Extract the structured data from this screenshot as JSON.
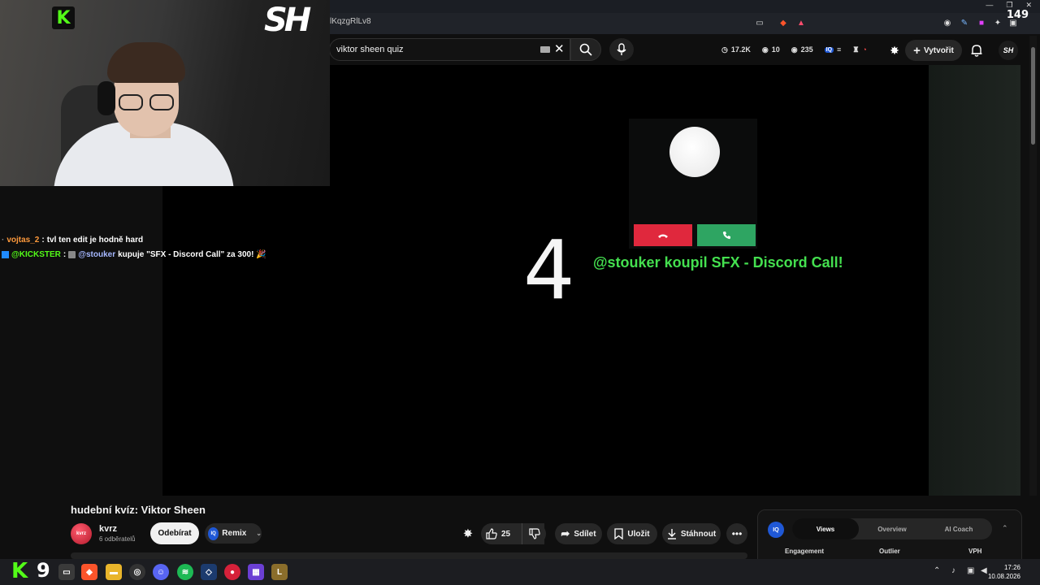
{
  "browser": {
    "url_fragment": "lKqzgRlLv8",
    "counter": "149"
  },
  "header": {
    "search_value": "viktor sheen quiz",
    "stats": {
      "likes": "17.2K",
      "views": "10",
      "watchers": "235"
    },
    "create_label": "Vytvořit",
    "avatar_text": "SH"
  },
  "video": {
    "countdown": "4",
    "alert": "@stouker koupil SFX - Discord Call!"
  },
  "overlay": {
    "kick_letter": "K",
    "sh_logo": "SH"
  },
  "chat": [
    {
      "user": "vojtas_2",
      "message": "tvl ten edit je hodně hard",
      "user_color": "#ff9a3c"
    },
    {
      "user": "@KICKSTER",
      "mention": "@stouker",
      "message": "kupuje \"SFX - Discord Call\" za 300! 🎉",
      "user_color": "#53fc18",
      "mention_color": "#a6b8ff"
    }
  ],
  "below": {
    "title": "hudební kvíz: Viktor Sheen",
    "channel_name": "kvrz",
    "channel_avatar_text": "kvrz",
    "subscribers": "6 odběratelů",
    "subscribe_label": "Odebírat",
    "remix_label": "Remix",
    "like_count": "25",
    "share_label": "Sdílet",
    "save_label": "Uložit",
    "download_label": "Stáhnout"
  },
  "vidiq": {
    "logo": "IQ",
    "tabs": [
      "Views",
      "Overview",
      "AI Coach"
    ],
    "active_tab": "Views",
    "columns": [
      "Engagement",
      "Outlier",
      "VPH"
    ]
  },
  "taskbar": {
    "kick_letter": "K",
    "number": "9",
    "time": "17:26",
    "date": "10.08.2026"
  },
  "colors": {
    "accent_green": "#44e04f",
    "decline_red": "#e0283d",
    "accept_green": "#2ea562",
    "kick_green": "#53fc18"
  }
}
